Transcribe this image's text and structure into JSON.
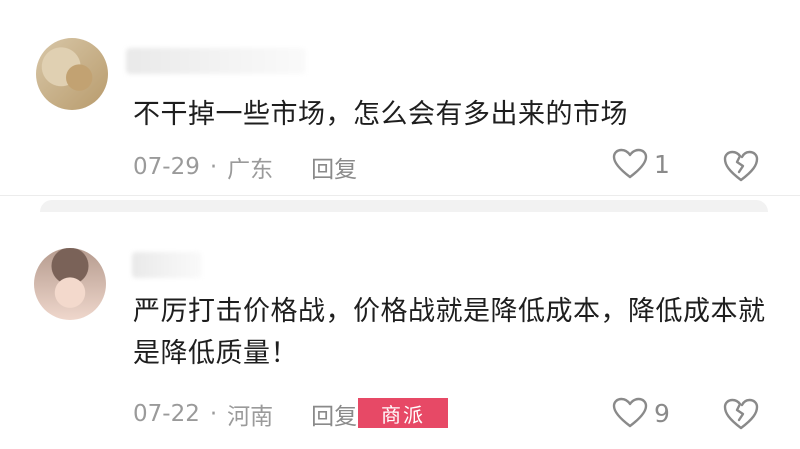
{
  "comments": [
    {
      "text": "不干掉一些市场，怎么会有多出来的市场",
      "date": "07-29",
      "separator": "·",
      "location": "广东",
      "reply_label": "回复",
      "like_count": "1"
    },
    {
      "text": "严厉打击价格战，价格战就是降低成本，降低成本就是降低质量！",
      "date": "07-22",
      "separator": "·",
      "location": "河南",
      "reply_label": "回复",
      "like_count": "9"
    }
  ],
  "icons": {
    "like": "heart-outline-icon",
    "dislike": "broken-heart-icon"
  },
  "colors": {
    "meta": "#9a9a9a",
    "text": "#1e1e1e",
    "watermark": "#e63a5a"
  },
  "watermark": {
    "text": "商派"
  }
}
